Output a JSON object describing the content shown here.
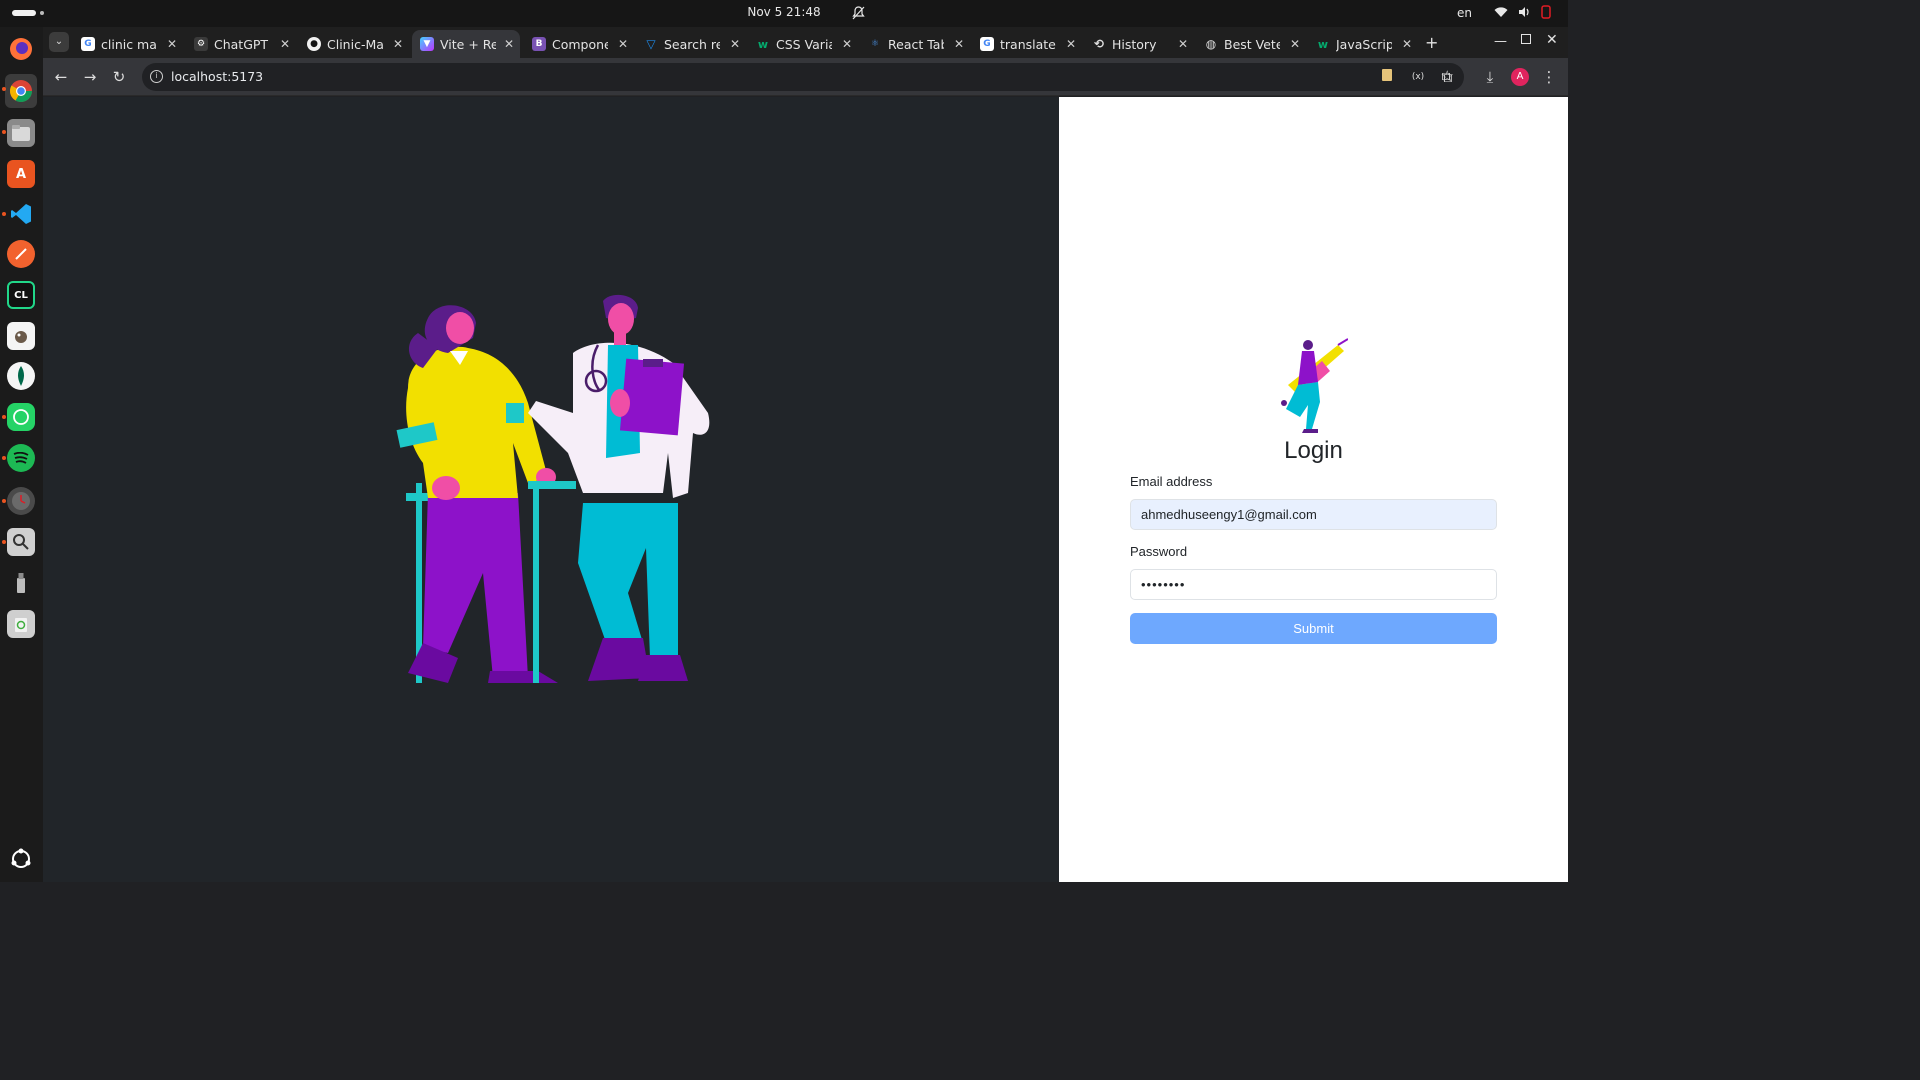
{
  "system": {
    "clock": "Nov 5  21:48",
    "language": "en"
  },
  "browser": {
    "tabs": [
      {
        "label": "clinic man",
        "icon": "google-icon",
        "active": false
      },
      {
        "label": "ChatGPT",
        "icon": "chatgpt-icon",
        "active": false
      },
      {
        "label": "Clinic-Mar",
        "icon": "github-icon",
        "active": false
      },
      {
        "label": "Vite + Rea",
        "icon": "vite-icon",
        "active": true
      },
      {
        "label": "Compone",
        "icon": "bootstrap-icon",
        "active": false
      },
      {
        "label": "Search re",
        "icon": "vuetify-icon",
        "active": false
      },
      {
        "label": "CSS Varia",
        "icon": "w3schools-icon",
        "active": false
      },
      {
        "label": "React Tab",
        "icon": "react-icon",
        "active": false
      },
      {
        "label": "translates",
        "icon": "google-icon",
        "active": false
      },
      {
        "label": "History",
        "icon": "history-icon",
        "active": false
      },
      {
        "label": "Best Vete",
        "icon": "globe-icon",
        "active": false
      },
      {
        "label": "JavaScrip",
        "icon": "w3schools-icon",
        "active": false
      }
    ],
    "url": "localhost:5173",
    "profile_initial": "A"
  },
  "login": {
    "title": "Login",
    "email_label": "Email address",
    "email_value": "ahmedhuseengy1@gmail.com",
    "password_label": "Password",
    "password_value": "••••••••",
    "submit_label": "Submit"
  },
  "colors": {
    "left_panel_bg": "#212529",
    "button_bg": "#6ea8fe",
    "email_autofill_bg": "#e8f0fe"
  }
}
